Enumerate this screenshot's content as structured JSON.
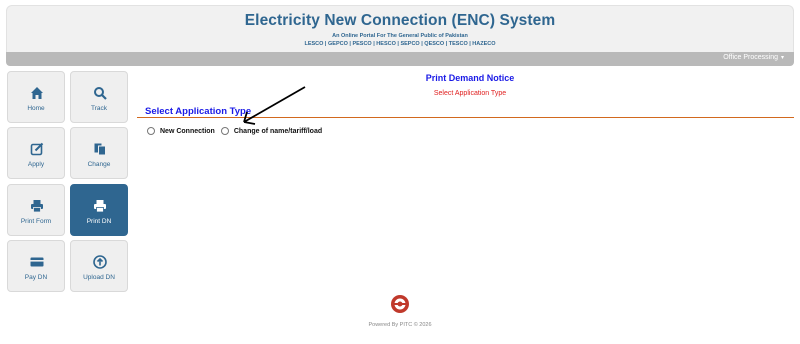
{
  "header": {
    "title": "Electricity New Connection (ENC) System",
    "subtitle": "An Online Portal For The General Public of Pakistan",
    "companies": "LESCO | GEPCO | PESCO | HESCO | SEPCO | QESCO | TESCO | HAZECO"
  },
  "menubar": {
    "office_label": "Office Processing",
    "caret": "▾"
  },
  "sidebar": {
    "items": [
      {
        "label": "Home",
        "icon": "home-icon"
      },
      {
        "label": "Track",
        "icon": "search-icon"
      },
      {
        "label": "Apply",
        "icon": "edit-icon"
      },
      {
        "label": "Change",
        "icon": "copy-icon"
      },
      {
        "label": "Print Form",
        "icon": "print-icon"
      },
      {
        "label": "Print DN",
        "icon": "print-icon",
        "active": true
      },
      {
        "label": "Pay DN",
        "icon": "credit-card-icon"
      },
      {
        "label": "Upload DN",
        "icon": "upload-icon"
      }
    ]
  },
  "main": {
    "title": "Print Demand Notice",
    "subtitle": "Select Application Type",
    "section_title": "Select Application Type",
    "options": [
      {
        "label": "New Connection",
        "checked": false
      },
      {
        "label": "Change of name/tariff/load",
        "checked": false
      }
    ]
  },
  "footer": {
    "text": "Powered By PITC © 2026"
  },
  "colors": {
    "brand_blue": "#2f6690",
    "heading_blue": "#1a1ae6",
    "alert_red": "#e02020",
    "divider_orange": "#d2691e",
    "logo_red": "#c0392b"
  }
}
